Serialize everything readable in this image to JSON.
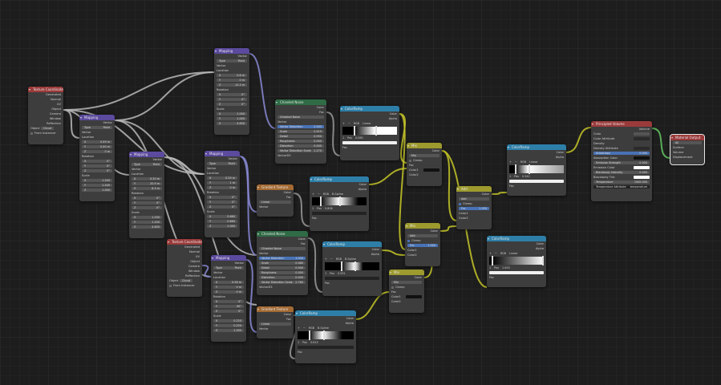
{
  "editor": {
    "name": "Shader Editor"
  },
  "nodes": {
    "texcoord1": {
      "title": "Texture Coordinate",
      "outputs": [
        "Generated",
        "Normal",
        "UV",
        "Object",
        "Camera",
        "Window",
        "Reflection"
      ],
      "object_label": "Object",
      "object_value": "Cloud",
      "from_instancer": "From Instancer"
    },
    "texcoord2": {
      "title": "Texture Coordinate",
      "outputs": [
        "Generated",
        "Normal",
        "UV",
        "Object",
        "Camera",
        "Window",
        "Reflection"
      ],
      "object_label": "Object",
      "object_value": "Cloud",
      "from_instancer": "From Instancer"
    },
    "mapping_top": {
      "title": "Mapping",
      "out": "Vector",
      "type_label": "Type",
      "type_value": "Point",
      "vector": "Vector",
      "location": "Location",
      "loc": [
        "0.8 m",
        "0 m",
        "12.3 m"
      ],
      "rotation": "Rotation",
      "rot": [
        "0°",
        "0°",
        "0°"
      ],
      "scale": "Scale",
      "scl": [
        "1.000",
        "1.000",
        "4.650"
      ]
    },
    "mapping_a": {
      "title": "Mapping",
      "out": "Vector",
      "type_label": "Type",
      "type_value": "Point",
      "vector": "Vector",
      "location": "Location",
      "loc": [
        "0.49 m",
        "0.40 m",
        "0 m"
      ],
      "rotation": "Rotation",
      "rot": [
        "0°",
        "0°",
        "0°"
      ],
      "scale": "Scale",
      "scl": [
        "1.200",
        "1.200",
        "1.000"
      ]
    },
    "mapping_b": {
      "title": "Mapping",
      "out": "Vector",
      "type_label": "Type",
      "type_value": "Point",
      "vector": "Vector",
      "location": "Location",
      "loc": [
        "0.30 m",
        "20.9 m",
        "8.3 m"
      ],
      "rotation": "Rotation",
      "rot": [
        "0°",
        "0°",
        "0°"
      ],
      "scale": "Scale",
      "scl": [
        "1.200",
        "1.200",
        "4.650"
      ]
    },
    "mapping_c": {
      "title": "Mapping",
      "out": "Vector",
      "type_label": "Type",
      "type_value": "Point",
      "vector": "Vector",
      "location": "Location",
      "loc": [
        "0.29 m",
        "1 m",
        "0 m"
      ],
      "rotation": "Rotation",
      "rot": [
        "0°",
        "0°",
        "0°"
      ],
      "scale": "Scale",
      "scl": [
        "0.660",
        "0.660",
        "1.000"
      ]
    },
    "mapping_d": {
      "title": "Mapping",
      "out": "Vector",
      "type_label": "Type",
      "type_value": "Point",
      "vector": "Vector",
      "location": "Location",
      "loc": [
        "0.36 m",
        "0 m",
        "0 m"
      ],
      "rotation": "Rotation",
      "rot": [
        "0°",
        "90°",
        "0°"
      ],
      "scale": "Scale",
      "scl": [
        "0.220",
        "0.220",
        "1.000"
      ]
    },
    "noise1": {
      "title": "Chiseled Noise",
      "out_color": "Color",
      "out_fac": "Fac",
      "type_value": "Chiseled Noise",
      "vector": "Vector",
      "fields": [
        [
          "Vector Distortion",
          "2.903"
        ],
        [
          "Scale",
          "0.919"
        ],
        [
          "Detail",
          "0.950"
        ],
        [
          "Roughness",
          "0.000"
        ],
        [
          "Distortion",
          "0.000"
        ],
        [
          "Vector Distortion Scale",
          "1.270"
        ]
      ],
      "extra": "VectorD3"
    },
    "noise2": {
      "title": "Chiseled Noise",
      "out_color": "Color",
      "out_fac": "Fac",
      "type_value": "Chiseled Noise",
      "vector": "Vector",
      "fields": [
        [
          "Vector Distortion",
          "1.000"
        ],
        [
          "Scale",
          "0.080"
        ],
        [
          "Detail",
          "0.900"
        ],
        [
          "Roughness",
          "0.000"
        ],
        [
          "Distortion",
          "0.000"
        ],
        [
          "Vector Distortion Scale",
          "2.780"
        ]
      ],
      "extra": "VectorD3"
    },
    "gradient1": {
      "title": "Gradient Texture",
      "out_color": "Color",
      "out_fac": "Fac",
      "type_value": "Linear",
      "vector": "Vector"
    },
    "gradient2": {
      "title": "Gradient Texture",
      "out_color": "Color",
      "out_fac": "Fac",
      "type_value": "Linear",
      "vector": "Vector"
    },
    "ramp1": {
      "title": "ColorRamp",
      "out_color": "Color",
      "out_alpha": "Alpha",
      "mode": "RGB",
      "interp": "Linear",
      "idx": "1",
      "pos_label": "Pos",
      "pos": "0.580",
      "fac": "Fac"
    },
    "ramp2": {
      "title": "ColorRamp",
      "out_color": "Color",
      "out_alpha": "Alpha",
      "mode": "RGB",
      "interp": "B-Spline",
      "idx": "1",
      "pos_label": "Pos",
      "pos": "0.608",
      "fac": "Fac"
    },
    "ramp3": {
      "title": "ColorRamp",
      "out_color": "Color",
      "out_alpha": "Alpha",
      "mode": "RGB",
      "interp": "B-Spline",
      "idx": "1",
      "pos_label": "Pos",
      "pos": "0.591",
      "fac": "Fac"
    },
    "ramp4": {
      "title": "ColorRamp",
      "out_color": "Color",
      "out_alpha": "Alpha",
      "mode": "RGB",
      "interp": "B-Spline",
      "idx": "1",
      "pos_label": "Pos",
      "pos": "0.615",
      "fac": "Fac"
    },
    "ramp5": {
      "title": "ColorRamp",
      "out_color": "Color",
      "out_alpha": "Alpha",
      "mode": "RGB",
      "interp": "Linear",
      "idx": "1",
      "pos_label": "Pos",
      "pos": "0.342",
      "fac": "Fac"
    },
    "ramp6": {
      "title": "ColorRamp",
      "out_color": "Color",
      "out_alpha": "Alpha",
      "mode": "RGB",
      "interp": "Linear",
      "idx": "1",
      "pos_label": "Pos",
      "pos": "1.000",
      "fac": "Fac"
    },
    "mix1": {
      "title": "Mix",
      "out": "Color",
      "blend": "Mix",
      "clamp": "Clamp",
      "fac": "Fac",
      "c1": "Color1",
      "c2": "Color2"
    },
    "mix2": {
      "title": "Mix",
      "out": "Color",
      "blend": "Add",
      "clamp": "Clamp",
      "fac": "Fac",
      "fac_val": "1.000",
      "c1": "Color1",
      "c2": "Color2"
    },
    "mix3": {
      "title": "Mix",
      "out": "Color",
      "blend": "Mix",
      "clamp": "Clamp",
      "fac": "Fac",
      "c1": "Color1",
      "c2": "Color2"
    },
    "add1": {
      "title": "Add",
      "out": "Color",
      "blend": "Add",
      "clamp": "Clamp",
      "fac": "Fac",
      "fac_val": "1.000",
      "c1": "Color1",
      "c2": "Color2"
    },
    "volume": {
      "title": "Principled Volume",
      "out": "Volume",
      "rows": [
        "Color",
        "Color Attribute",
        "Density",
        "Density Attribute",
        "Anisotropy",
        "Absorption Color",
        "Emission Strength",
        "Emission Color",
        "Blackbody Intensity",
        "Blackbody Tint",
        "Temperature",
        "Temperature Attribute"
      ],
      "values": {
        "Anisotropy": "0.000",
        "Emission Strength": "0.000",
        "Blackbody Intensity": "0.000",
        "Temperature": "1000.000",
        "Temperature Attribute": "temperature"
      }
    },
    "output": {
      "title": "Material Output",
      "target": "All",
      "rows": [
        "Surface",
        "Volume",
        "Displacement"
      ]
    }
  }
}
